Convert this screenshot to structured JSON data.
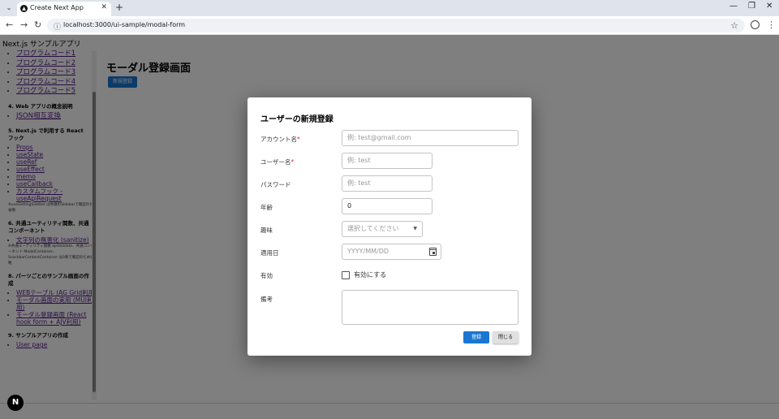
{
  "browser": {
    "tab_title": "Create Next App",
    "url": "localhost:3000/ui-sample/modal-form"
  },
  "page": {
    "app_title": "Next.js サンプルアプリ",
    "main_title": "モーダル登録画面",
    "new_button": "新規登録"
  },
  "sidebar": {
    "code_links": [
      "プログラムコード1",
      "プログラムコード2",
      "プログラムコード3",
      "プログラムコード4",
      "プログラムコード5"
    ],
    "section4": "4. Web アプリの概念説明",
    "section4_links": [
      "JSON相互変換"
    ],
    "section5": "5. Next.js で利用する React フック",
    "section5_links": [
      "Props",
      "useState",
      "useRef",
      "useEffect",
      "memo",
      "useCallback"
    ],
    "section5_custom": "カスタムフック - useApiRequest",
    "section5_note": "※useGettingSidebar は共通のSidebarで確認のため省略",
    "section6": "6. 共通ユーティリティ関数、共通コンポーネント",
    "section6_link": "文字列の無害化 (sanitize)",
    "section6_note": "※共通ユーティリティ関数 apiValidate、共通コンポーネント ModalContainer、SnackbarContentContainer は0章で確認のため省略",
    "section8": "8. パーツごとのサンプル画面の作成",
    "section8_links": [
      "WEBテーブル (AG Grid利用)",
      "モーダル画面の実用 (MUI利用)",
      "モーダル登録画面 (React hook form + AJV利用)"
    ],
    "section9": "9. サンプルアプリの作成",
    "section9_links": [
      "User page"
    ]
  },
  "modal": {
    "title": "ユーザーの新規登録",
    "fields": {
      "account_label": "アカウント名",
      "account_placeholder": "例: test@gmail.com",
      "username_label": "ユーザー名",
      "username_placeholder": "例: test",
      "password_label": "パスワード",
      "password_placeholder": "例: test",
      "age_label": "年齢",
      "age_value": "0",
      "hobby_label": "趣味",
      "hobby_placeholder": "選択してください",
      "date_label": "適用日",
      "date_placeholder": "YYYY/MM/DD",
      "active_label": "有効",
      "active_checkbox_label": "有効にする",
      "notes_label": "備考"
    },
    "required_mark": "*",
    "submit_label": "登録",
    "close_label": "閉じる"
  },
  "colors": {
    "primary": "#1976d2",
    "required": "#d32f2f",
    "link": "#551a8b"
  }
}
